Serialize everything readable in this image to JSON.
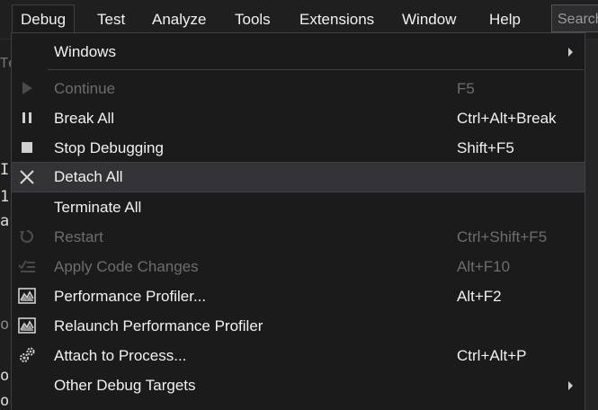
{
  "menubar": {
    "items": [
      {
        "label": "Debug"
      },
      {
        "label": "Test"
      },
      {
        "label": "Analyze"
      },
      {
        "label": "Tools"
      },
      {
        "label": "Extensions"
      },
      {
        "label": "Window"
      },
      {
        "label": "Help"
      }
    ],
    "search_placeholder": "Search"
  },
  "debug_menu": {
    "items": [
      {
        "label": "Windows",
        "shortcut": "",
        "icon": "none",
        "submenu": true,
        "enabled": true
      },
      {
        "label": "Continue",
        "shortcut": "F5",
        "icon": "play-icon",
        "enabled": false
      },
      {
        "label": "Break All",
        "shortcut": "Ctrl+Alt+Break",
        "icon": "pause-icon",
        "enabled": true
      },
      {
        "label": "Stop Debugging",
        "shortcut": "Shift+F5",
        "icon": "stop-icon",
        "enabled": true
      },
      {
        "label": "Detach All",
        "shortcut": "",
        "icon": "close-icon",
        "enabled": true,
        "highlighted": true
      },
      {
        "label": "Terminate All",
        "shortcut": "",
        "icon": "none",
        "enabled": true
      },
      {
        "label": "Restart",
        "shortcut": "Ctrl+Shift+F5",
        "icon": "restart-icon",
        "enabled": false
      },
      {
        "label": "Apply Code Changes",
        "shortcut": "Alt+F10",
        "icon": "apply-changes-icon",
        "enabled": false
      },
      {
        "label": "Performance Profiler...",
        "shortcut": "Alt+F2",
        "icon": "profiler-icon",
        "enabled": true
      },
      {
        "label": "Relaunch Performance Profiler",
        "shortcut": "",
        "icon": "profiler-icon",
        "enabled": true
      },
      {
        "label": "Attach to Process...",
        "shortcut": "Ctrl+Alt+P",
        "icon": "gears-icon",
        "enabled": true
      },
      {
        "label": "Other Debug Targets",
        "shortcut": "",
        "icon": "none",
        "submenu": true,
        "enabled": true
      }
    ]
  },
  "background": {
    "glyphs": [
      "Te",
      "I",
      "1",
      "a",
      "o",
      "o",
      "o"
    ]
  }
}
